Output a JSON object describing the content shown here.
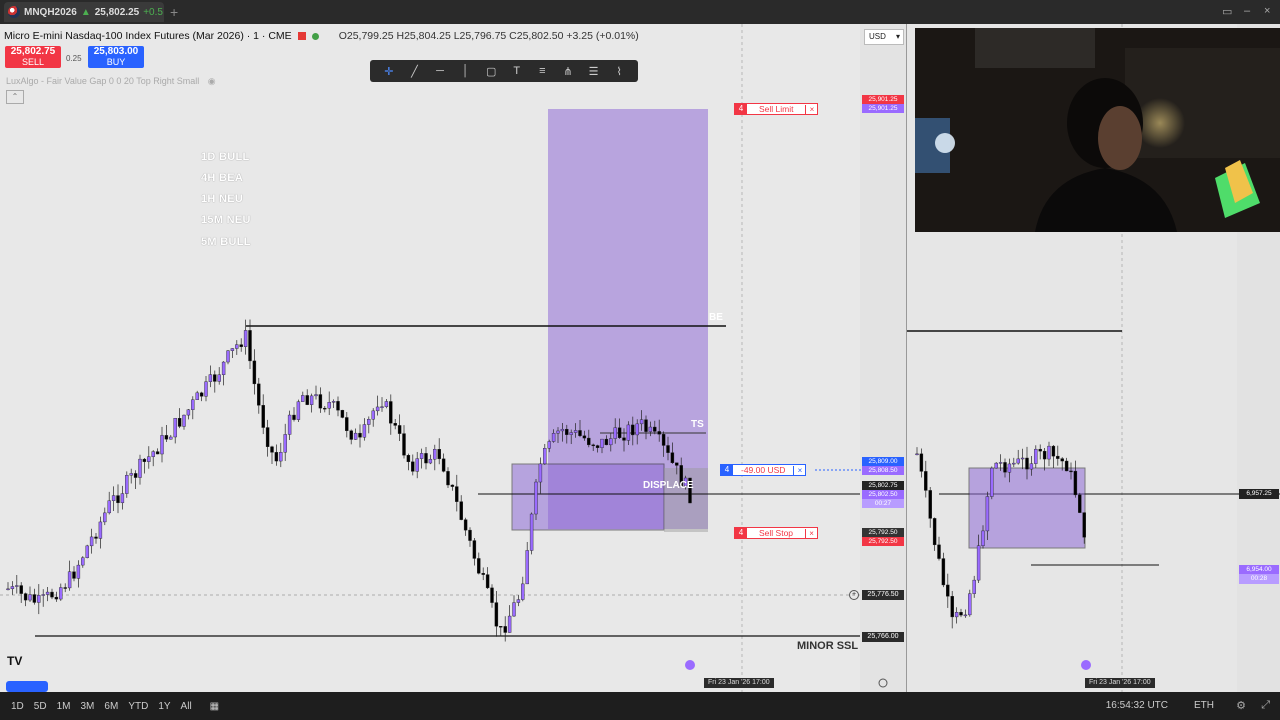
{
  "tab": {
    "symbol": "MNQH2026",
    "arrow": "▲",
    "price": "25,802.25",
    "change": "+0.5"
  },
  "header": {
    "title": "Micro E-mini Nasdaq-100 Index Futures (Mar 2026) · 1 · CME",
    "ohlc": "O25,799.25  H25,804.25  L25,796.75  C25,802.50  +3.25 (+0.01%)",
    "currency": "USD"
  },
  "trade": {
    "sell_price": "25,802.75",
    "sell_label": "SELL",
    "spread": "0.25",
    "buy_price": "25,803.00",
    "buy_label": "BUY"
  },
  "indicator": {
    "name": "LuxAlgo - Fair Value Gap 0 0 20 Top Right Small"
  },
  "bias": [
    {
      "label": "1D BULL"
    },
    {
      "label": "4H BEA"
    },
    {
      "label": "1H NEU"
    },
    {
      "label": "15M NEU"
    },
    {
      "label": "5M BULL"
    }
  ],
  "drawing_tools": [
    "crosshair-icon",
    "trendline-icon",
    "horizontal-line-icon",
    "vertical-line-icon",
    "rectangle-icon",
    "text-icon",
    "fib-icon",
    "pitchfork-icon",
    "lines-icon",
    "path-icon"
  ],
  "orders": {
    "sell_limit": {
      "qty": "4",
      "label": "Sell Limit",
      "close": "×"
    },
    "position": {
      "qty": "4",
      "label": "-49.00 USD",
      "close": "×"
    },
    "sell_stop": {
      "qty": "4",
      "label": "Sell Stop",
      "close": "×"
    }
  },
  "labels": {
    "be": "BE",
    "ts": "TS",
    "displace": "DISPLACE",
    "minor_ssl": "MINOR SSL"
  },
  "price_tags": {
    "sell_limit_a": "25,901.25",
    "sell_limit_b": "25,901.25",
    "position_a": "25,809.00",
    "position_b": "25,808.50",
    "current": "25,802.75",
    "current_b": "25,802.50",
    "current_c": "00:27",
    "stop_a": "25,792.50",
    "stop_b": "25,792.50",
    "crosshair": "25,776.50",
    "ssl": "25,766.00"
  },
  "time_tags": {
    "main": "Fri 23 Jan '26   17:00",
    "right": "Fri 23 Jan '26   17:00"
  },
  "right_panel": {
    "price_a": "6,957.25",
    "price_b": "6,954.00",
    "price_c": "00:28"
  },
  "timeframes": [
    "1D",
    "5D",
    "1M",
    "3M",
    "6M",
    "YTD",
    "1Y",
    "All"
  ],
  "status": {
    "clock": "16:54:32 UTC",
    "session": "ETH"
  },
  "colors": {
    "sell": "#f23645",
    "buy": "#2962ff",
    "bull_candle": "#9a6bff",
    "bear_candle": "#000000",
    "zone": "#8f6bd6"
  }
}
